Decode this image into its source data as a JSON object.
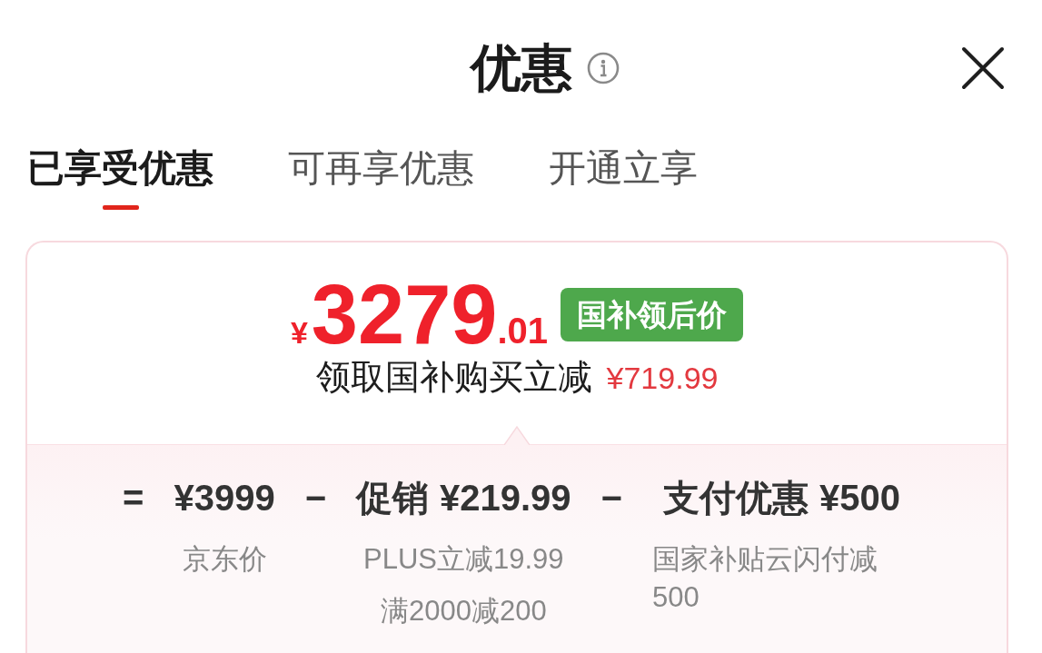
{
  "header": {
    "title": "优惠"
  },
  "tabs": [
    {
      "label": "已享受优惠",
      "selected": true
    },
    {
      "label": "可再享优惠",
      "selected": false
    },
    {
      "label": "开通立享",
      "selected": false
    }
  ],
  "price_card": {
    "price": {
      "currency": "¥",
      "integer": "3279",
      "decimal": ".01"
    },
    "badge": "国补领后价",
    "saving": {
      "text": "领取国补购买立减",
      "amount": "¥719.99"
    },
    "breakdown": [
      {
        "kind": "operator",
        "symbol": "="
      },
      {
        "kind": "term",
        "amount": "¥3999",
        "notes": [
          "京东价"
        ]
      },
      {
        "kind": "operator",
        "symbol": "−"
      },
      {
        "kind": "term",
        "label": "促销",
        "amount": "¥219.99",
        "notes": [
          "PLUS立减19.99",
          "满2000减200"
        ]
      },
      {
        "kind": "operator",
        "symbol": "−"
      },
      {
        "kind": "term",
        "label": "支付优惠",
        "amount": "¥500",
        "notes": [
          "国家补贴云闪付减500"
        ]
      }
    ]
  }
}
